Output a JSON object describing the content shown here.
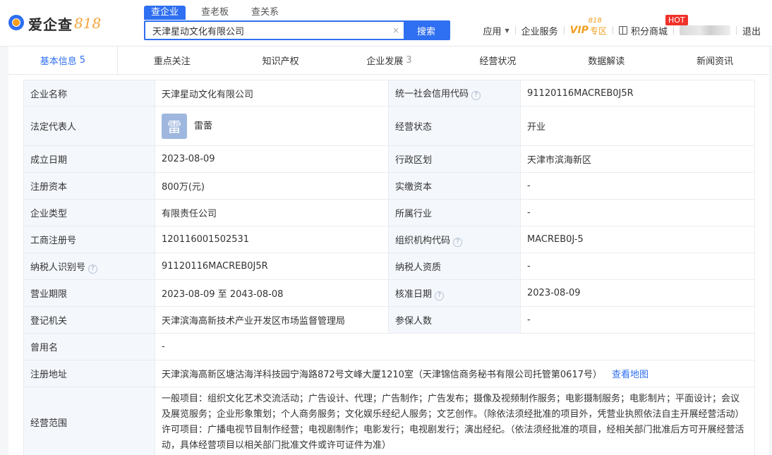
{
  "logo": {
    "text": "爱企查",
    "num": "818"
  },
  "search": {
    "tabs": [
      "查企业",
      "查老板",
      "查关系"
    ],
    "value": "天津星动文化有限公司",
    "clear": "×",
    "button": "搜索"
  },
  "nav": {
    "apps": "应用",
    "services": "企业服务",
    "vip": "VIP",
    "vip_sub": "专区",
    "vip_badge": "818",
    "points": "积分商城",
    "hot": "HOT",
    "logout": "退出"
  },
  "tabs": [
    {
      "label": "基本信息",
      "count": "5"
    },
    {
      "label": "重点关注",
      "count": ""
    },
    {
      "label": "知识产权",
      "count": ""
    },
    {
      "label": "企业发展",
      "count": "3"
    },
    {
      "label": "经营状况",
      "count": ""
    },
    {
      "label": "数据解读",
      "count": ""
    },
    {
      "label": "新闻资讯",
      "count": ""
    }
  ],
  "info": {
    "name_label": "企业名称",
    "name": "天津星动文化有限公司",
    "credit_label": "统一社会信用代码",
    "credit": "91120116MACREB0J5R",
    "legal_label": "法定代表人",
    "legal_avatar": "雷",
    "legal": "雷蕾",
    "status_label": "经营状态",
    "status": "开业",
    "est_label": "成立日期",
    "est": "2023-08-09",
    "region_label": "行政区划",
    "region": "天津市滨海新区",
    "capital_label": "注册资本",
    "capital": "800万(元)",
    "paid_label": "实缴资本",
    "paid": "-",
    "type_label": "企业类型",
    "type": "有限责任公司",
    "industry_label": "所属行业",
    "industry": "-",
    "regno_label": "工商注册号",
    "regno": "120116001502531",
    "orgcode_label": "组织机构代码",
    "orgcode": "MACREB0J-5",
    "taxid_label": "纳税人识别号",
    "taxid": "91120116MACREB0J5R",
    "taxqual_label": "纳税人资质",
    "taxqual": "-",
    "term_label": "营业期限",
    "term": "2023-08-09 至 2043-08-08",
    "approve_label": "核准日期",
    "approve": "2023-08-09",
    "authority_label": "登记机关",
    "authority": "天津滨海高新技术产业开发区市场监督管理局",
    "insured_label": "参保人数",
    "insured": "-",
    "former_label": "曾用名",
    "former": "-",
    "address_label": "注册地址",
    "address": "天津滨海高新区塘沽海洋科技园宁海路872号文峰大厦1210室（天津锦信商务秘书有限公司托管第0617号）",
    "map_link": "查看地图",
    "scope_label": "经营范围",
    "scope": "一般项目：组织文化艺术交流活动；广告设计、代理；广告制作；广告发布；摄像及视频制作服务；电影摄制服务；电影制片；平面设计；会议及展览服务；企业形象策划；个人商务服务；文化娱乐经纪人服务；文艺创作。（除依法须经批准的项目外，凭营业执照依法自主开展经营活动）许可项目：广播电视节目制作经营；电视剧制作；电影发行；电视剧发行；演出经纪。（依法须经批准的项目，经相关部门批准后方可开展经营活动，具体经营项目以相关部门批准文件或许可证件为准）"
  },
  "help_glyph": "?"
}
